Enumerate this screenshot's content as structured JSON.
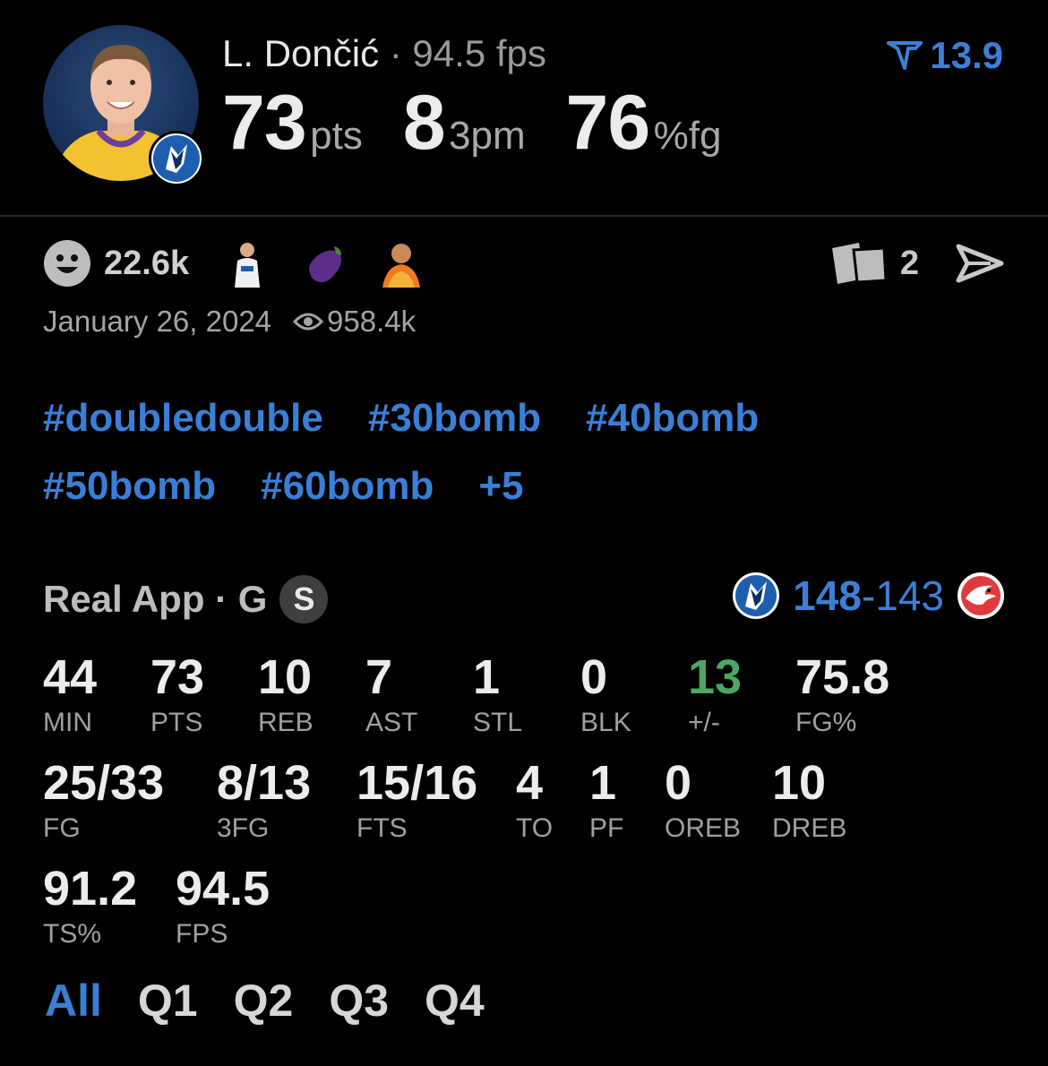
{
  "player": {
    "name": "L. Dončić",
    "separator": "·",
    "fps": "94.5 fps",
    "headline": [
      {
        "value": "73",
        "unit": "pts"
      },
      {
        "value": "8",
        "unit": "3pm"
      },
      {
        "value": "76",
        "unit": "%fg"
      }
    ],
    "rating": "13.9"
  },
  "reactions": {
    "count": "22.6k",
    "emojis": [
      "player-emoji",
      "eggplant-emoji",
      "fire-person-emoji"
    ],
    "share_count": "2"
  },
  "post": {
    "date": "January 26, 2024",
    "views": "958.4k"
  },
  "tags": [
    "#doubledouble",
    "#30bomb",
    "#40bomb",
    "#50bomb",
    "#60bomb",
    "+5"
  ],
  "source": {
    "name": "Real App · G",
    "badge": "S"
  },
  "score": {
    "home": "148",
    "sep": "-",
    "away": "143"
  },
  "stats": {
    "row1": [
      {
        "value": "44",
        "label": "MIN"
      },
      {
        "value": "73",
        "label": "PTS"
      },
      {
        "value": "10",
        "label": "REB"
      },
      {
        "value": "7",
        "label": "AST"
      },
      {
        "value": "1",
        "label": "STL"
      },
      {
        "value": "0",
        "label": "BLK"
      },
      {
        "value": "13",
        "label": "+/-"
      },
      {
        "value": "75.8",
        "label": "FG%"
      }
    ],
    "row2": [
      {
        "value": "25/33",
        "label": "FG"
      },
      {
        "value": "8/13",
        "label": "3FG"
      },
      {
        "value": "15/16",
        "label": "FTS"
      },
      {
        "value": "4",
        "label": "TO"
      },
      {
        "value": "1",
        "label": "PF"
      },
      {
        "value": "0",
        "label": "OREB"
      },
      {
        "value": "10",
        "label": "DREB"
      }
    ],
    "row3": [
      {
        "value": "91.2",
        "label": "TS%"
      },
      {
        "value": "94.5",
        "label": "FPS"
      }
    ]
  },
  "periods": [
    "All",
    "Q1",
    "Q2",
    "Q3",
    "Q4"
  ],
  "colors": {
    "accent": "#3a7fd6",
    "positive": "#4aa861",
    "background": "#000000"
  }
}
